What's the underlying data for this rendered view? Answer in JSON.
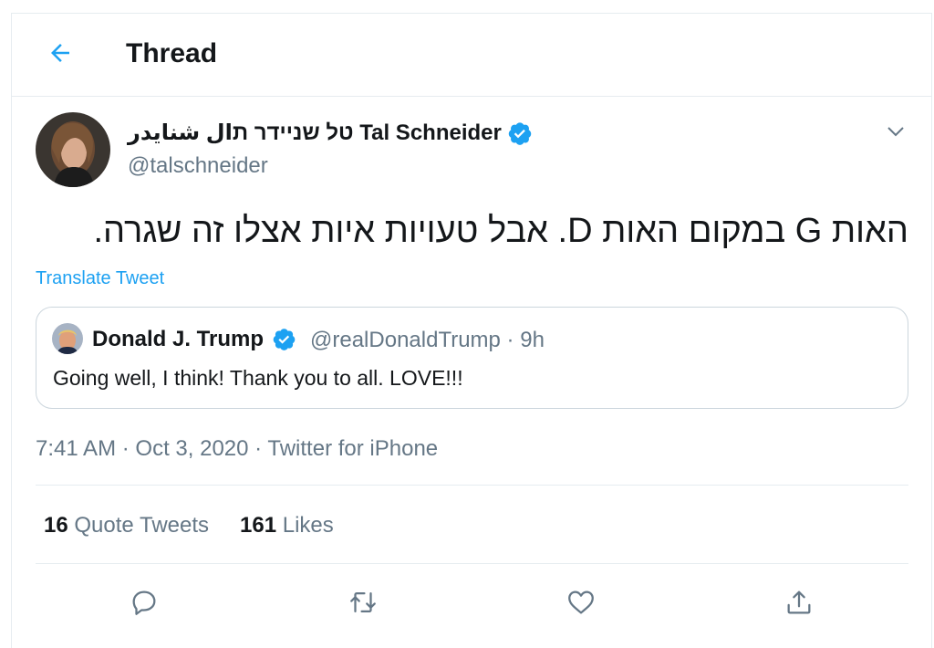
{
  "header": {
    "title": "Thread",
    "back_icon": "arrow-left-icon",
    "accent": "#1da1f2"
  },
  "tweet": {
    "display_name": "טל שניידר תال شنايدر Tal Schneider",
    "handle": "@talschneider",
    "text": "האות G במקום האות D. אבל טעויות איות אצלו זה שגרה.",
    "translate_label": "Translate Tweet",
    "time": "7:41 AM",
    "date": "Oct 3, 2020",
    "source": "Twitter for iPhone",
    "separator": "·"
  },
  "quote": {
    "name": "Donald J. Trump",
    "handle_time": "@realDonaldTrump · 9h",
    "text": "Going well, I think! Thank you to all. LOVE!!!"
  },
  "stats": {
    "quote_count": "16",
    "quote_label": "Quote Tweets",
    "likes_count": "161",
    "likes_label": "Likes"
  },
  "actions": [
    "reply-icon",
    "retweet-icon",
    "like-icon",
    "share-icon"
  ],
  "colors": {
    "text": "#14171a",
    "secondary": "#657786",
    "border": "#e6ecf0",
    "accent": "#1da1f2"
  }
}
